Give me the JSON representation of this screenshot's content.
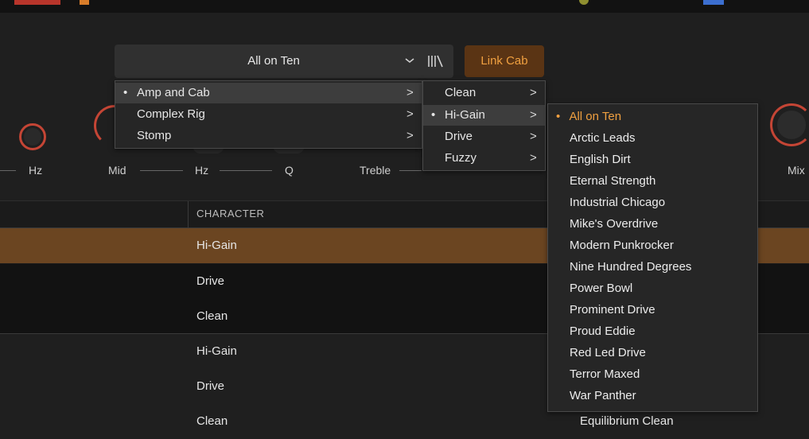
{
  "preset_selector": {
    "value": "All on Ten"
  },
  "link_cab": {
    "label": "Link Cab",
    "color": "#f0a040"
  },
  "controls": {
    "hz_left": "Hz",
    "mid": "Mid",
    "hz_mid": "Hz",
    "q": "Q",
    "treble": "Treble",
    "mix": "Mix"
  },
  "category_menu": {
    "items": [
      {
        "label": "Amp and Cab",
        "selected": true
      },
      {
        "label": "Complex Rig",
        "selected": false
      },
      {
        "label": "Stomp",
        "selected": false
      }
    ],
    "arrow": ">"
  },
  "character_menu": {
    "items": [
      {
        "label": "Clean",
        "selected": false
      },
      {
        "label": "Hi-Gain",
        "selected": true
      },
      {
        "label": "Drive",
        "selected": false
      },
      {
        "label": "Fuzzy",
        "selected": false
      }
    ],
    "arrow": ">"
  },
  "preset_menu": {
    "items": [
      {
        "label": "All on Ten",
        "selected": true
      },
      {
        "label": "Arctic Leads"
      },
      {
        "label": "English Dirt"
      },
      {
        "label": "Eternal Strength"
      },
      {
        "label": "Industrial Chicago"
      },
      {
        "label": "Mike's Overdrive"
      },
      {
        "label": "Modern Punkrocker"
      },
      {
        "label": "Nine Hundred Degrees"
      },
      {
        "label": "Power Bowl"
      },
      {
        "label": "Prominent Drive"
      },
      {
        "label": "Proud Eddie"
      },
      {
        "label": "Red Led Drive"
      },
      {
        "label": "Terror Maxed"
      },
      {
        "label": "War Panther"
      }
    ],
    "selected_color": "#f0a040"
  },
  "table": {
    "column_header": "CHARACTER",
    "rows": [
      {
        "character": "Hi-Gain",
        "selected": true
      },
      {
        "character": "Drive"
      },
      {
        "character": "Clean"
      },
      {
        "character": "Hi-Gain"
      },
      {
        "character": "Drive"
      },
      {
        "character": "Clean"
      }
    ],
    "partial_preset": "Equilibrium Clean",
    "selected_row_color": "#6b4521"
  },
  "bullet": "•"
}
